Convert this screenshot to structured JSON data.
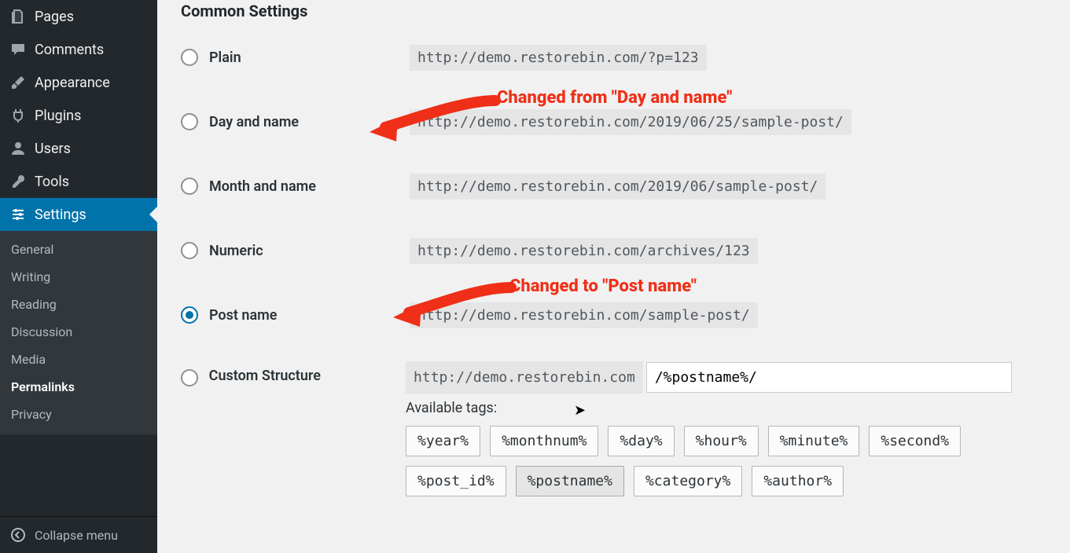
{
  "sidebar": {
    "items": [
      {
        "label": "Pages",
        "icon": "pages"
      },
      {
        "label": "Comments",
        "icon": "comment"
      },
      {
        "label": "Appearance",
        "icon": "brush"
      },
      {
        "label": "Plugins",
        "icon": "plug"
      },
      {
        "label": "Users",
        "icon": "user"
      },
      {
        "label": "Tools",
        "icon": "wrench"
      },
      {
        "label": "Settings",
        "icon": "sliders",
        "active": true
      }
    ],
    "submenu": [
      {
        "label": "General"
      },
      {
        "label": "Writing"
      },
      {
        "label": "Reading"
      },
      {
        "label": "Discussion"
      },
      {
        "label": "Media"
      },
      {
        "label": "Permalinks",
        "current": true
      },
      {
        "label": "Privacy"
      }
    ],
    "collapse": "Collapse menu"
  },
  "section_title": "Common Settings",
  "options": [
    {
      "label": "Plain",
      "example": "http://demo.restorebin.com/?p=123"
    },
    {
      "label": "Day and name",
      "example": "http://demo.restorebin.com/2019/06/25/sample-post/"
    },
    {
      "label": "Month and name",
      "example": "http://demo.restorebin.com/2019/06/sample-post/"
    },
    {
      "label": "Numeric",
      "example": "http://demo.restorebin.com/archives/123"
    },
    {
      "label": "Post name",
      "example": "http://demo.restorebin.com/sample-post/",
      "checked": true
    },
    {
      "label": "Custom Structure"
    }
  ],
  "custom": {
    "base_url": "http://demo.restorebin.com",
    "value": "/%postname%/",
    "available_label": "Available tags:"
  },
  "tags": [
    "%year%",
    "%monthnum%",
    "%day%",
    "%hour%",
    "%minute%",
    "%second%",
    "%post_id%",
    "%postname%",
    "%category%",
    "%author%"
  ],
  "tag_active": "%postname%",
  "annotations": {
    "from": "Changed from \"Day and name\"",
    "to": "Changed to \"Post name\""
  }
}
